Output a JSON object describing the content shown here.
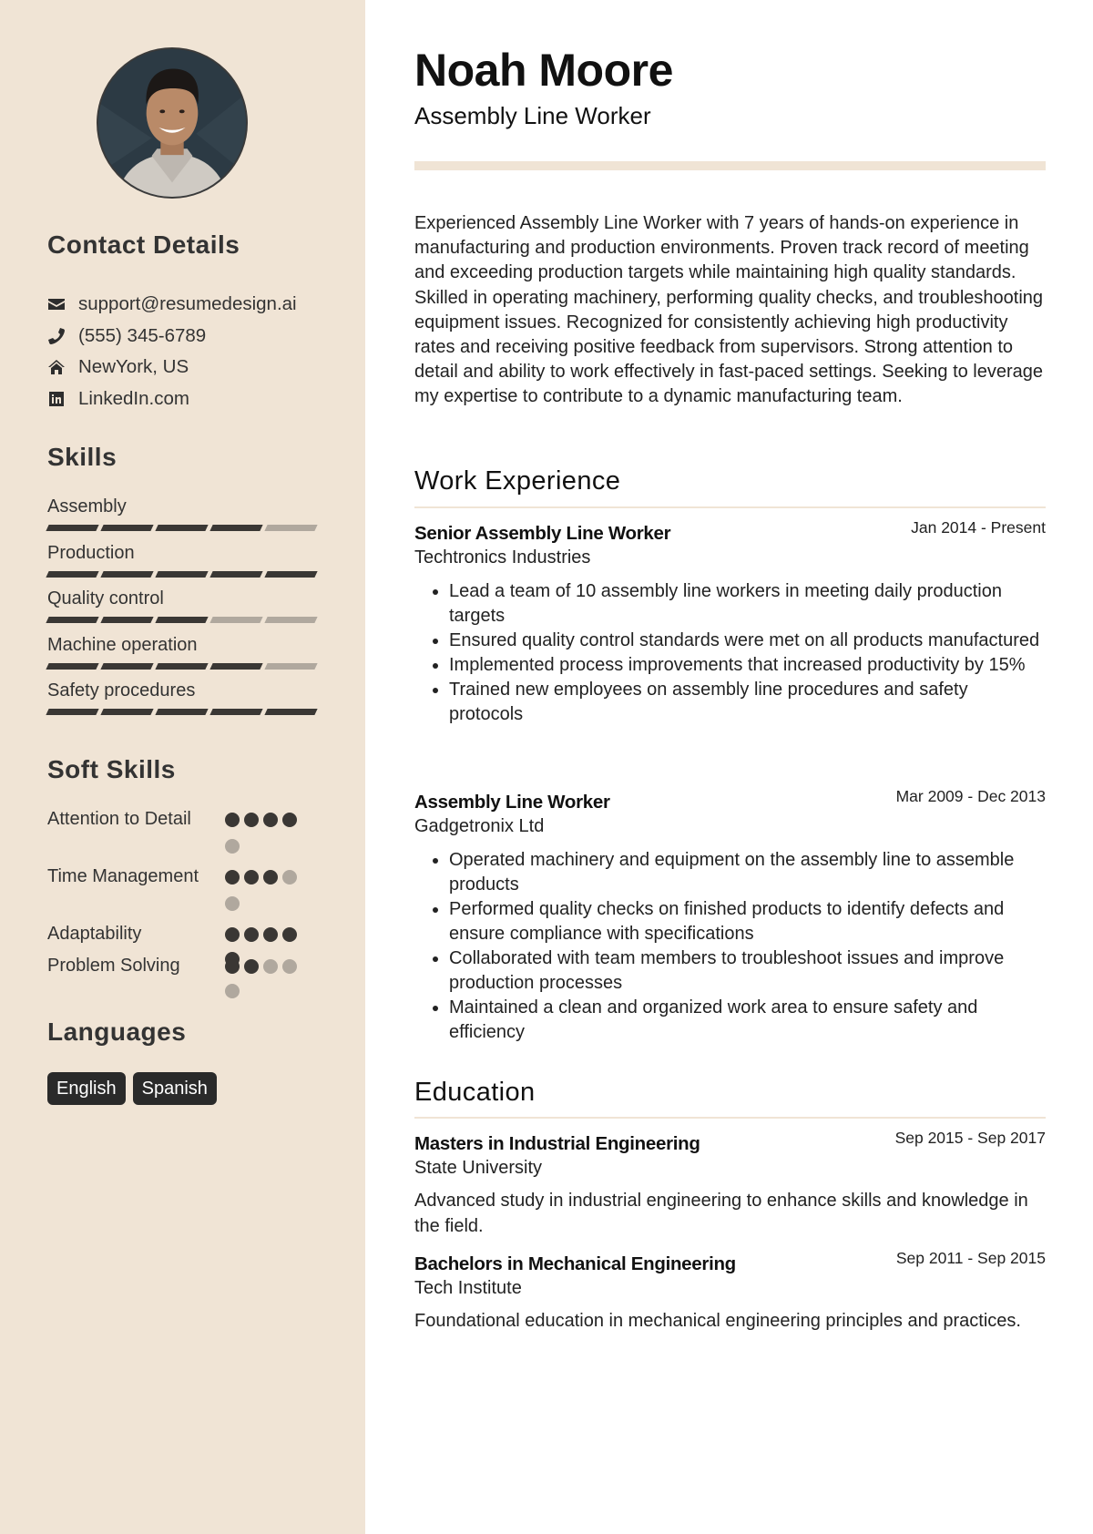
{
  "profile": {
    "name": "Noah Moore",
    "title": "Assembly Line Worker",
    "photo_alt": "Profile photo"
  },
  "sidebar": {
    "contact": {
      "heading": "Contact Details",
      "items": [
        {
          "icon": "envelope-icon",
          "value": "support@resumedesign.ai"
        },
        {
          "icon": "phone-icon",
          "value": "(555) 345-6789"
        },
        {
          "icon": "home-icon",
          "value": "NewYork, US"
        },
        {
          "icon": "linkedin-icon",
          "value": "LinkedIn.com"
        }
      ]
    },
    "skills": {
      "heading": "Skills",
      "max": 5,
      "items": [
        {
          "name": "Assembly",
          "level": 4
        },
        {
          "name": "Production",
          "level": 5
        },
        {
          "name": "Quality control",
          "level": 3
        },
        {
          "name": "Machine operation",
          "level": 4
        },
        {
          "name": "Safety procedures",
          "level": 5
        }
      ]
    },
    "soft_skills": {
      "heading": "Soft Skills",
      "max": 5,
      "items": [
        {
          "name": "Attention to Detail",
          "level": 4
        },
        {
          "name": "Time Management",
          "level": 3
        },
        {
          "name": "Adaptability",
          "level": 5
        },
        {
          "name": "Problem Solving",
          "level": 2
        }
      ]
    },
    "languages": {
      "heading": "Languages",
      "items": [
        "English",
        "Spanish"
      ]
    }
  },
  "summary": "Experienced Assembly Line Worker with 7 years of hands-on experience in manufacturing and production environments. Proven track record of meeting and exceeding production targets while maintaining high quality standards. Skilled in operating machinery, performing quality checks, and troubleshooting equipment issues. Recognized for consistently achieving high productivity rates and receiving positive feedback from supervisors. Strong attention to detail and ability to work effectively in fast-paced settings. Seeking to leverage my expertise to contribute to a dynamic manufacturing team.",
  "work": {
    "heading": "Work Experience",
    "items": [
      {
        "title": "Senior Assembly Line Worker",
        "company": "Techtronics Industries",
        "dates": "Jan 2014 - Present",
        "bullets": [
          "Lead a team of 10 assembly line workers in meeting daily production targets",
          "Ensured quality control standards were met on all products manufactured",
          "Implemented process improvements that increased productivity by 15%",
          "Trained new employees on assembly line procedures and safety protocols"
        ]
      },
      {
        "title": "Assembly Line Worker",
        "company": "Gadgetronix Ltd",
        "dates": "Mar 2009 - Dec 2013",
        "bullets": [
          "Operated machinery and equipment on the assembly line to assemble products",
          "Performed quality checks on finished products to identify defects and ensure compliance with specifications",
          "Collaborated with team members to troubleshoot issues and improve production processes",
          "Maintained a clean and organized work area to ensure safety and efficiency"
        ]
      }
    ]
  },
  "education": {
    "heading": "Education",
    "items": [
      {
        "degree": "Masters in Industrial Engineering",
        "school": "State University",
        "dates": "Sep 2015 - Sep 2017",
        "description": "Advanced study in industrial engineering to enhance skills and knowledge in the field."
      },
      {
        "degree": "Bachelors in Mechanical Engineering",
        "school": "Tech Institute",
        "dates": "Sep 2011 - Sep 2015",
        "description": "Foundational education in mechanical engineering principles and practices."
      }
    ]
  },
  "colors": {
    "sidebar_bg": "#f0e4d5",
    "accent_dark": "#3a3734",
    "accent_muted": "#b0a89e",
    "badge_bg": "#2a2a2a"
  }
}
